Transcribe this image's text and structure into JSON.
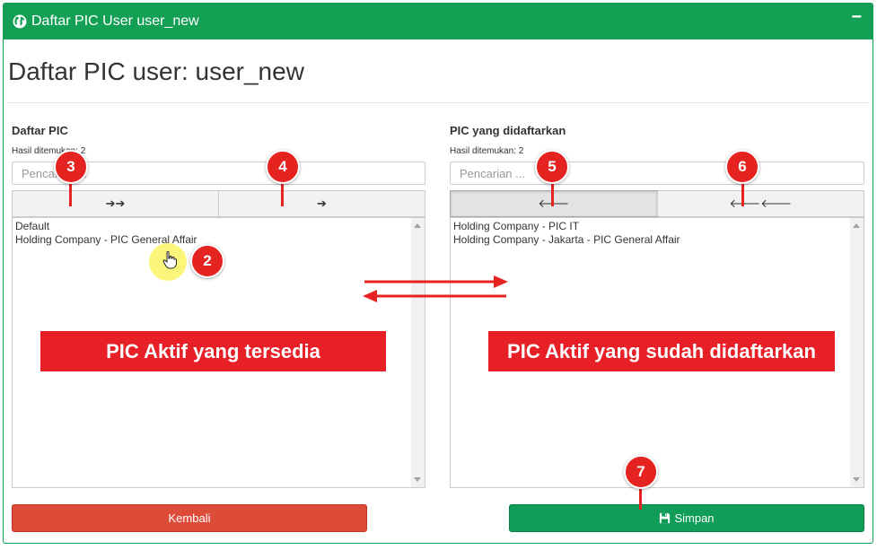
{
  "header": {
    "title": "Daftar PIC User user_new",
    "collapse_label": "−"
  },
  "page_title": "Daftar PIC user: user_new",
  "left": {
    "label": "Daftar PIC",
    "count_text": "Hasil ditemukan: 2",
    "search_placeholder": "Pencarian ...",
    "btn_all_icon": "➔➔",
    "btn_one_icon": "➔",
    "items": [
      "Default",
      "Holding Company - PIC General Affair"
    ]
  },
  "right": {
    "label": "PIC yang didaftarkan",
    "count_text": "Hasil ditemukan: 2",
    "search_placeholder": "Pencarian ...",
    "btn_one_icon": "🡐",
    "btn_all_icon": "🡐🡐",
    "items": [
      "Holding Company - PIC IT",
      "Holding Company - Jakarta - PIC General Affair"
    ]
  },
  "buttons": {
    "back": "Kembali",
    "save": "Simpan"
  },
  "annotations": {
    "left_callout": "PIC Aktif yang tersedia",
    "right_callout": "PIC Aktif yang sudah didaftarkan",
    "badges": [
      "2",
      "3",
      "4",
      "5",
      "6",
      "7"
    ]
  },
  "colors": {
    "header": "#13a054",
    "danger": "#dd4b39",
    "success": "#0f9d58",
    "annotation": "#e52321"
  },
  "icons": {
    "header": "globe-icon",
    "cursor": "hand-pointer-icon",
    "save": "floppy-disk-icon"
  }
}
